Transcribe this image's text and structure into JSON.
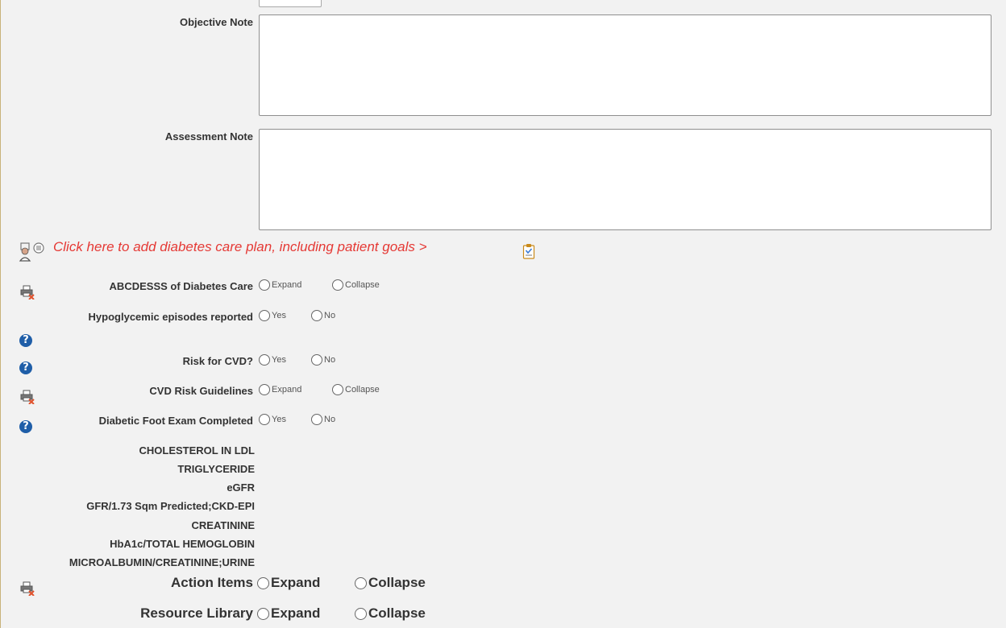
{
  "notes": {
    "objective_label": "Objective Note",
    "assessment_label": "Assessment Note"
  },
  "care_plan": {
    "link_text": "Click here to add diabetes care plan, including patient goals >"
  },
  "rows": {
    "abcdesss": {
      "label": "ABCDESSS of Diabetes Care",
      "opt1": "Expand",
      "opt2": "Collapse"
    },
    "hypo": {
      "label": "Hypoglycemic episodes reported",
      "opt1": "Yes",
      "opt2": "No"
    },
    "cvd": {
      "label": "Risk for CVD?",
      "opt1": "Yes",
      "opt2": "No"
    },
    "cvd_guidelines": {
      "label": "CVD Risk Guidelines",
      "opt1": "Expand",
      "opt2": "Collapse"
    },
    "foot": {
      "label": "Diabetic Foot Exam Completed",
      "opt1": "Yes",
      "opt2": "No"
    }
  },
  "labs": [
    "CHOLESTEROL IN LDL",
    "TRIGLYCERIDE",
    "eGFR",
    "GFR/1.73 Sqm Predicted;CKD-EPI",
    "CREATININE",
    "HbA1c/TOTAL HEMOGLOBIN",
    "MICROALBUMIN/CREATININE;URINE"
  ],
  "sections": {
    "action_items": {
      "label": "Action Items",
      "opt1": "Expand",
      "opt2": "Collapse"
    },
    "resource_library": {
      "label": "Resource Library",
      "opt1": "Expand",
      "opt2": "Collapse"
    }
  },
  "icons": {
    "care_plan": "care-plan-person-icon",
    "clipboard": "clipboard-check-icon",
    "print_remove": "print-remove-icon",
    "help": "help-question-icon"
  },
  "colors": {
    "link_red": "#e53935",
    "help_blue": "#1f5ea8"
  }
}
